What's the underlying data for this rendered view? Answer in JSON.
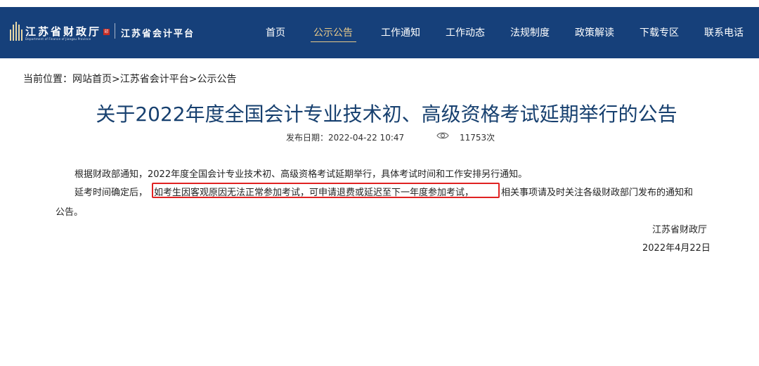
{
  "header": {
    "logo_main": "江苏省财政厅",
    "logo_sub": "Department of Finance of Jiangsu Province",
    "seal": "印",
    "platform": "江苏省会计平台",
    "nav": [
      "首页",
      "公示公告",
      "工作通知",
      "工作动态",
      "法规制度",
      "政策解读",
      "下载专区",
      "联系电话"
    ],
    "active_nav": "公示公告"
  },
  "breadcrumb": "当前位置：网站首页>江苏省会计平台>公示公告",
  "article": {
    "title": "关于2022年度全国会计专业技术初、高级资格考试延期举行的公告",
    "publish_label": "发布日期：2022-04-22 10:47",
    "views": "11753次",
    "paragraph_1": "根据财政部通知，2022年度全国会计专业技术初、高级资格考试延期举行，具体考试时间和工作安排另行通知。",
    "paragraph_2_start": "延考时间确定后，",
    "paragraph_2_highlight": "如考生因客观原因无法正常参加考试，可申请退费或延迟至下一年度参加考试，",
    "paragraph_2_end": "相关事项请及时关注各级财政部门发布的通知和",
    "paragraph_2_wrap": "公告。",
    "signature": "江苏省财政厅",
    "date": "2022年4月22日"
  },
  "colors": {
    "header_bg": "#16407a",
    "active_nav": "#e7c98a",
    "title": "#17406f",
    "highlight_border": "#e02222"
  }
}
